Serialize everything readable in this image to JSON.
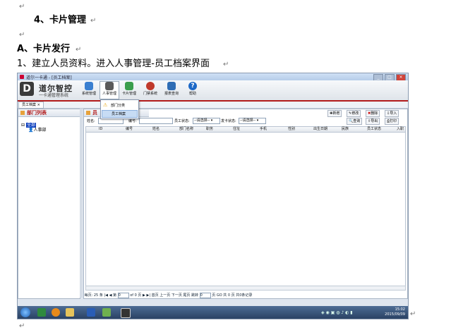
{
  "doc": {
    "heading": "4、卡片管理",
    "section": "A、卡片发行",
    "step": "1、建立人员资料。进入人事管理-员工档案界面"
  },
  "app": {
    "window_title": "道尔一卡通 - [员工档案]",
    "brand_name": "道尔智控",
    "brand_sub": "一卡通管理系统",
    "nav": [
      {
        "label": "系统管理",
        "color": "#3a7fd0"
      },
      {
        "label": "人事管理",
        "color": "#5a5a5a"
      },
      {
        "label": "卡片管理",
        "color": "#3b9e4c"
      },
      {
        "label": "门禁系统",
        "color": "#c0392b"
      },
      {
        "label": "报表查询",
        "color": "#2f6db5"
      },
      {
        "label": "帮助",
        "color": "#1c68c7"
      }
    ],
    "dropdown": {
      "item1": "部门分类",
      "item2": "员工档案"
    },
    "tab": "员工档案",
    "left_panel": {
      "title": "部门列表",
      "root": "全部",
      "child": "人事部"
    },
    "main_panel": {
      "title": "员",
      "buttons": {
        "add": "新增",
        "edit": "修改",
        "delete": "删除",
        "import": "导入",
        "query": "查询",
        "export": "导出",
        "print": "打印"
      },
      "filters": {
        "name_label": "姓名:",
        "number_label": "编号:",
        "status_label": "员工状态:",
        "status_value": "--请选择--",
        "card_status_label": "发卡状态:",
        "card_status_value": "--请选择--"
      },
      "columns": [
        "ID",
        "编号",
        "姓名",
        "部门名称",
        "职务",
        "住址",
        "手机",
        "性别",
        "出生日期",
        "民族",
        "员工状态",
        "入职"
      ]
    },
    "pager": {
      "page_size_label": "每页:",
      "page_size": "25",
      "rows_label": "条",
      "page_label": "第",
      "page_value": "0",
      "of_label": "of 0 页",
      "first": "首页",
      "prev": "上一页",
      "next": "下一页",
      "last": "尾页",
      "jump_label": "跳转",
      "jump_value": "0",
      "page_unit": "页",
      "go": "GO",
      "total_prefix": "共",
      "total_count": "0",
      "total_page_unit": "页",
      "total_records": "共0条记录"
    },
    "taskbar": {
      "time": "15:02",
      "date": "2015/09/09"
    }
  }
}
